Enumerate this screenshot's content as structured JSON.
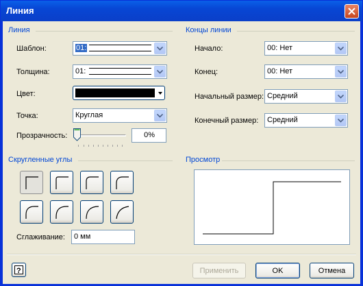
{
  "window": {
    "title": "Линия"
  },
  "line_group": {
    "title": "Линия",
    "pattern_label": "Шаблон:",
    "pattern_value": "01:",
    "weight_label": "Толщина:",
    "weight_value": "01:",
    "color_label": "Цвет:",
    "color_value": "#000000",
    "cap_label": "Точка:",
    "cap_value": "Круглая",
    "transparency_label": "Прозрачность:",
    "transparency_value": "0%",
    "transparency_level": 0
  },
  "ends_group": {
    "title": "Концы линии",
    "begin_label": "Начало:",
    "begin_value": "00: Нет",
    "end_label": "Конец:",
    "end_value": "00: Нет",
    "begin_size_label": "Начальный размер:",
    "begin_size_value": "Средний",
    "end_size_label": "Конечный размер:",
    "end_size_value": "Средний"
  },
  "rounded_group": {
    "title": "Скругленные углы",
    "smoothing_label": "Сглаживание:",
    "smoothing_value": "0 мм"
  },
  "preview_group": {
    "title": "Просмотр"
  },
  "buttons": {
    "apply": "Применить",
    "ok": "OK",
    "cancel": "Отмена"
  },
  "colors": {
    "title_bar": "#0a5fe8",
    "group_title": "#0046d5",
    "dialog_bg": "#ece9d8"
  }
}
